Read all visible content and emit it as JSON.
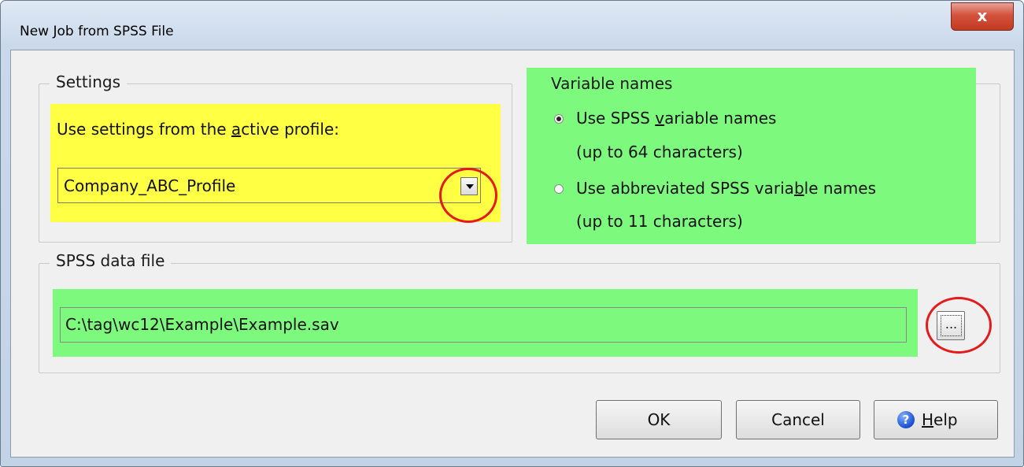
{
  "window": {
    "title": "New Job from SPSS File",
    "close_glyph": "x"
  },
  "settings": {
    "group_label": "Settings",
    "label_prefix": "Use settings from the ",
    "label_mnemonic": "a",
    "label_suffix": "ctive profile:",
    "profile_value": "Company_ABC_Profile",
    "highlight_color": "#ffff44"
  },
  "variable_names": {
    "group_label": "Variable names",
    "highlight_color": "#7dfa7d",
    "options": [
      {
        "pre": "Use SPSS ",
        "mn": "v",
        "post": "ariable names",
        "sub": "(up to 64 characters)",
        "checked": true
      },
      {
        "pre": "Use abbreviated SPSS varia",
        "mn": "b",
        "post": "le names",
        "sub": "(up to 11 characters)",
        "checked": false
      }
    ]
  },
  "data_file": {
    "group_label": "SPSS data file",
    "path": "C:\\tag\\wc12\\Example\\Example.sav",
    "browse_label": "...",
    "highlight_color": "#7dfa7d"
  },
  "buttons": {
    "ok": "OK",
    "cancel": "Cancel",
    "help_mnemonic": "H",
    "help_rest": "elp",
    "help_icon_glyph": "?"
  },
  "annotation_color": "#e51a1a"
}
